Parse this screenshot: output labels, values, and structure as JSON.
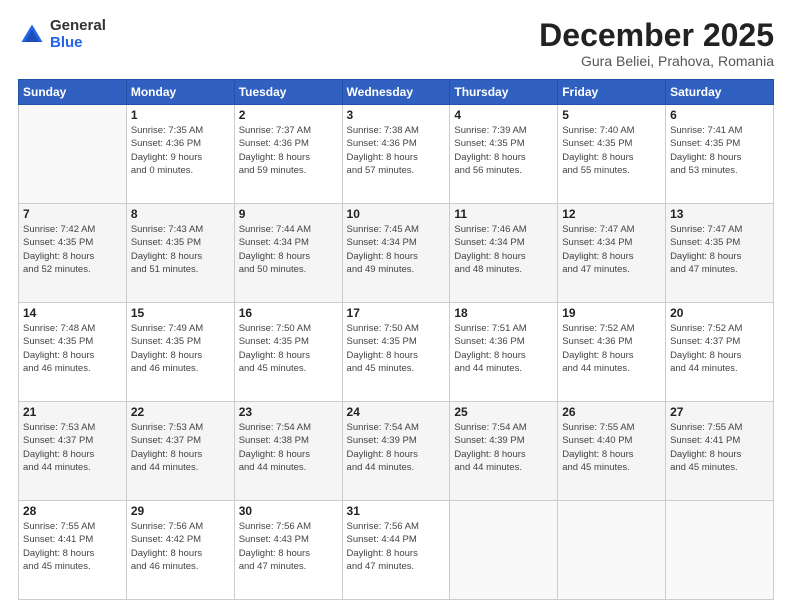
{
  "logo": {
    "general": "General",
    "blue": "Blue"
  },
  "header": {
    "month": "December 2025",
    "location": "Gura Beliei, Prahova, Romania"
  },
  "weekdays": [
    "Sunday",
    "Monday",
    "Tuesday",
    "Wednesday",
    "Thursday",
    "Friday",
    "Saturday"
  ],
  "weeks": [
    [
      {
        "day": "",
        "detail": ""
      },
      {
        "day": "1",
        "detail": "Sunrise: 7:35 AM\nSunset: 4:36 PM\nDaylight: 9 hours\nand 0 minutes."
      },
      {
        "day": "2",
        "detail": "Sunrise: 7:37 AM\nSunset: 4:36 PM\nDaylight: 8 hours\nand 59 minutes."
      },
      {
        "day": "3",
        "detail": "Sunrise: 7:38 AM\nSunset: 4:36 PM\nDaylight: 8 hours\nand 57 minutes."
      },
      {
        "day": "4",
        "detail": "Sunrise: 7:39 AM\nSunset: 4:35 PM\nDaylight: 8 hours\nand 56 minutes."
      },
      {
        "day": "5",
        "detail": "Sunrise: 7:40 AM\nSunset: 4:35 PM\nDaylight: 8 hours\nand 55 minutes."
      },
      {
        "day": "6",
        "detail": "Sunrise: 7:41 AM\nSunset: 4:35 PM\nDaylight: 8 hours\nand 53 minutes."
      }
    ],
    [
      {
        "day": "7",
        "detail": "Sunrise: 7:42 AM\nSunset: 4:35 PM\nDaylight: 8 hours\nand 52 minutes."
      },
      {
        "day": "8",
        "detail": "Sunrise: 7:43 AM\nSunset: 4:35 PM\nDaylight: 8 hours\nand 51 minutes."
      },
      {
        "day": "9",
        "detail": "Sunrise: 7:44 AM\nSunset: 4:34 PM\nDaylight: 8 hours\nand 50 minutes."
      },
      {
        "day": "10",
        "detail": "Sunrise: 7:45 AM\nSunset: 4:34 PM\nDaylight: 8 hours\nand 49 minutes."
      },
      {
        "day": "11",
        "detail": "Sunrise: 7:46 AM\nSunset: 4:34 PM\nDaylight: 8 hours\nand 48 minutes."
      },
      {
        "day": "12",
        "detail": "Sunrise: 7:47 AM\nSunset: 4:34 PM\nDaylight: 8 hours\nand 47 minutes."
      },
      {
        "day": "13",
        "detail": "Sunrise: 7:47 AM\nSunset: 4:35 PM\nDaylight: 8 hours\nand 47 minutes."
      }
    ],
    [
      {
        "day": "14",
        "detail": "Sunrise: 7:48 AM\nSunset: 4:35 PM\nDaylight: 8 hours\nand 46 minutes."
      },
      {
        "day": "15",
        "detail": "Sunrise: 7:49 AM\nSunset: 4:35 PM\nDaylight: 8 hours\nand 46 minutes."
      },
      {
        "day": "16",
        "detail": "Sunrise: 7:50 AM\nSunset: 4:35 PM\nDaylight: 8 hours\nand 45 minutes."
      },
      {
        "day": "17",
        "detail": "Sunrise: 7:50 AM\nSunset: 4:35 PM\nDaylight: 8 hours\nand 45 minutes."
      },
      {
        "day": "18",
        "detail": "Sunrise: 7:51 AM\nSunset: 4:36 PM\nDaylight: 8 hours\nand 44 minutes."
      },
      {
        "day": "19",
        "detail": "Sunrise: 7:52 AM\nSunset: 4:36 PM\nDaylight: 8 hours\nand 44 minutes."
      },
      {
        "day": "20",
        "detail": "Sunrise: 7:52 AM\nSunset: 4:37 PM\nDaylight: 8 hours\nand 44 minutes."
      }
    ],
    [
      {
        "day": "21",
        "detail": "Sunrise: 7:53 AM\nSunset: 4:37 PM\nDaylight: 8 hours\nand 44 minutes."
      },
      {
        "day": "22",
        "detail": "Sunrise: 7:53 AM\nSunset: 4:37 PM\nDaylight: 8 hours\nand 44 minutes."
      },
      {
        "day": "23",
        "detail": "Sunrise: 7:54 AM\nSunset: 4:38 PM\nDaylight: 8 hours\nand 44 minutes."
      },
      {
        "day": "24",
        "detail": "Sunrise: 7:54 AM\nSunset: 4:39 PM\nDaylight: 8 hours\nand 44 minutes."
      },
      {
        "day": "25",
        "detail": "Sunrise: 7:54 AM\nSunset: 4:39 PM\nDaylight: 8 hours\nand 44 minutes."
      },
      {
        "day": "26",
        "detail": "Sunrise: 7:55 AM\nSunset: 4:40 PM\nDaylight: 8 hours\nand 45 minutes."
      },
      {
        "day": "27",
        "detail": "Sunrise: 7:55 AM\nSunset: 4:41 PM\nDaylight: 8 hours\nand 45 minutes."
      }
    ],
    [
      {
        "day": "28",
        "detail": "Sunrise: 7:55 AM\nSunset: 4:41 PM\nDaylight: 8 hours\nand 45 minutes."
      },
      {
        "day": "29",
        "detail": "Sunrise: 7:56 AM\nSunset: 4:42 PM\nDaylight: 8 hours\nand 46 minutes."
      },
      {
        "day": "30",
        "detail": "Sunrise: 7:56 AM\nSunset: 4:43 PM\nDaylight: 8 hours\nand 47 minutes."
      },
      {
        "day": "31",
        "detail": "Sunrise: 7:56 AM\nSunset: 4:44 PM\nDaylight: 8 hours\nand 47 minutes."
      },
      {
        "day": "",
        "detail": ""
      },
      {
        "day": "",
        "detail": ""
      },
      {
        "day": "",
        "detail": ""
      }
    ]
  ]
}
